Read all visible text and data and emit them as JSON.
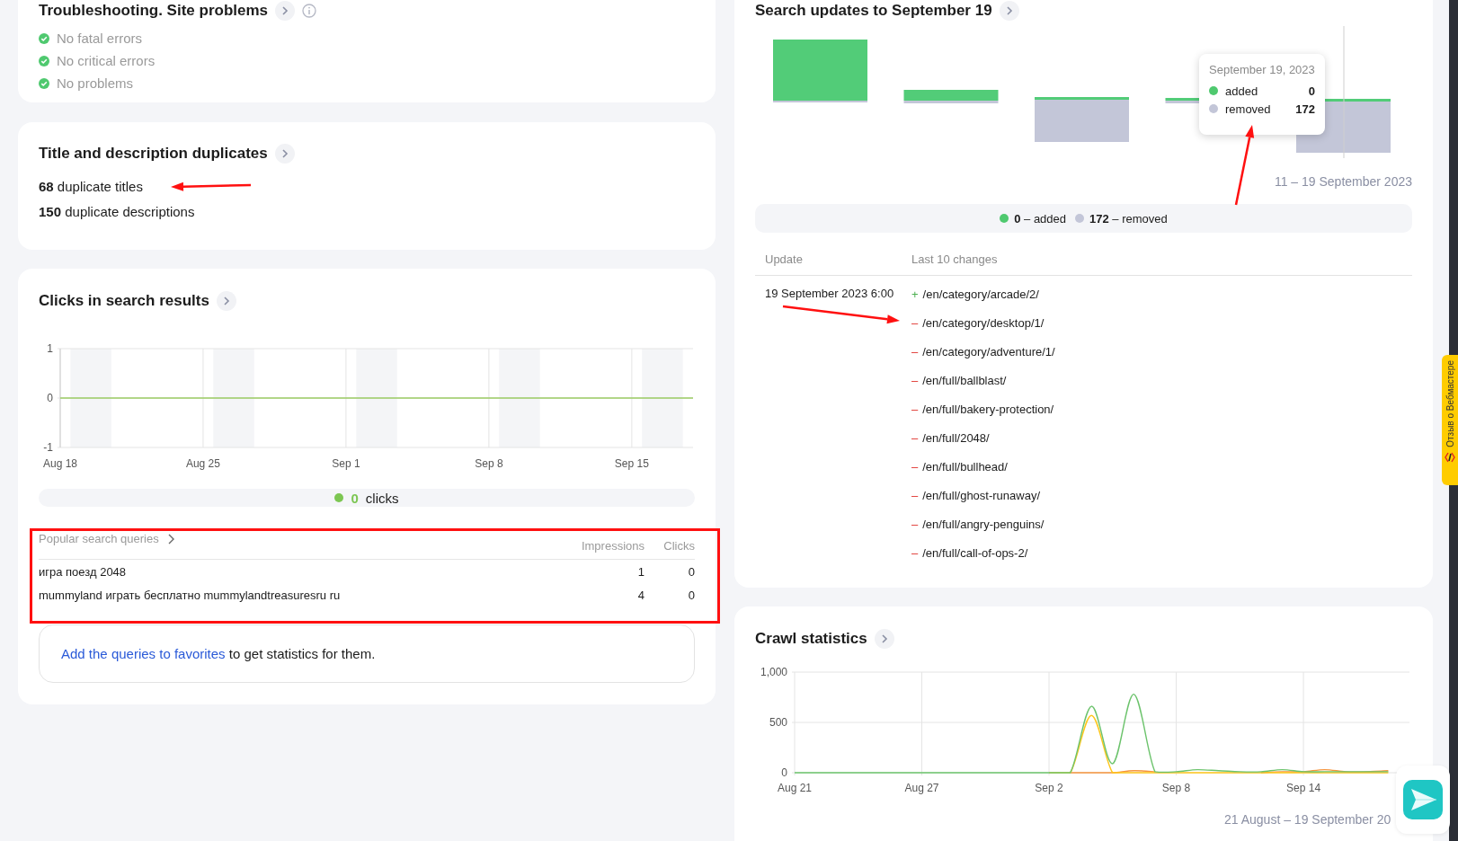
{
  "site_problems": {
    "title": "Troubleshooting. Site problems",
    "items": [
      "No fatal errors",
      "No critical errors",
      "No problems"
    ]
  },
  "duplicates": {
    "title": "Title and description duplicates",
    "lines": [
      {
        "count": "68",
        "label": "duplicate titles"
      },
      {
        "count": "150",
        "label": "duplicate descriptions"
      }
    ]
  },
  "clicks": {
    "title": "Clicks in search results",
    "chart_data": {
      "type": "line",
      "grid": true,
      "categories": [
        "Aug 18",
        null,
        null,
        null,
        null,
        null,
        null,
        "Aug 25",
        null,
        null,
        null,
        null,
        null,
        null,
        "Sep 1",
        null,
        null,
        null,
        null,
        null,
        null,
        "Sep 8",
        null,
        null,
        null,
        null,
        null,
        null,
        "Sep 15",
        null,
        null,
        null
      ],
      "ylim": [
        -1,
        1
      ],
      "yticks": [
        -1,
        0,
        1
      ],
      "series": [
        {
          "color": "#9ccc65",
          "values": [
            0,
            0,
            0,
            0,
            0,
            0,
            0,
            0,
            0,
            0,
            0,
            0,
            0,
            0,
            0,
            0,
            0,
            0,
            0,
            0,
            0,
            0,
            0,
            0,
            0,
            0,
            0,
            0,
            0,
            0,
            0,
            0
          ]
        }
      ]
    },
    "legend": {
      "value": "0",
      "label": "clicks",
      "color": "#7cc652"
    },
    "queries": {
      "title": "Popular search queries",
      "columns": [
        "Impressions",
        "Clicks"
      ],
      "rows": [
        {
          "query": "игра поезд 2048",
          "impressions": "1",
          "clicks": "0"
        },
        {
          "query": "mummyland играть бесплатно mummylandtreasuresru ru",
          "impressions": "4",
          "clicks": "0"
        }
      ]
    },
    "favorites_note": {
      "link": "Add the queries to favorites",
      "text": "to get statistics for them."
    }
  },
  "search_updates": {
    "title": "Search updates to September 19",
    "tooltip": {
      "date": "September 19, 2023",
      "rows": [
        {
          "label": "added",
          "value": "0",
          "color": "#4fc96f"
        },
        {
          "label": "removed",
          "value": "172",
          "color": "#c3c6d8"
        }
      ]
    },
    "period": "11 – 19 September 2023",
    "legend": [
      {
        "text": "**0** – added",
        "color": "#4fc96f"
      },
      {
        "text": "**172** – removed",
        "color": "#c3c6d8"
      }
    ],
    "columns": [
      "Update",
      "Last 10 changes"
    ],
    "update_date": "19 September 2023 6:00",
    "changes": [
      {
        "kind": "added",
        "sign": "+",
        "path": "/en/category/arcade/2/"
      },
      {
        "kind": "removed",
        "sign": "–",
        "path": "/en/category/desktop/1/"
      },
      {
        "kind": "removed",
        "sign": "–",
        "path": "/en/category/adventure/1/"
      },
      {
        "kind": "removed",
        "sign": "–",
        "path": "/en/full/ballblast/"
      },
      {
        "kind": "removed",
        "sign": "–",
        "path": "/en/full/bakery-protection/"
      },
      {
        "kind": "removed",
        "sign": "–",
        "path": "/en/full/2048/"
      },
      {
        "kind": "removed",
        "sign": "–",
        "path": "/en/full/bullhead/"
      },
      {
        "kind": "removed",
        "sign": "–",
        "path": "/en/full/ghost-runaway/"
      },
      {
        "kind": "removed",
        "sign": "–",
        "path": "/en/full/angry-penguins/"
      },
      {
        "kind": "removed",
        "sign": "–",
        "path": "/en/full/call-of-ops-2/"
      }
    ]
  },
  "crawl": {
    "title": "Crawl statistics",
    "chart_data": {
      "type": "line",
      "grid": true,
      "categories": [
        "Aug 21",
        null,
        null,
        null,
        null,
        null,
        "Aug 27",
        null,
        null,
        null,
        null,
        null,
        "Sep 2",
        null,
        null,
        null,
        null,
        null,
        "Sep 8",
        null,
        null,
        null,
        null,
        null,
        "Sep 14",
        null,
        null,
        null,
        null,
        null
      ],
      "ylim": [
        0,
        1000
      ],
      "yticks": [
        0,
        500,
        {
          "value": 1000,
          "label": "1,000"
        }
      ],
      "series": [
        {
          "color": "#6cc36c",
          "values": [
            0,
            0,
            0,
            0,
            0,
            0,
            0,
            0,
            0,
            0,
            0,
            0,
            0,
            0,
            660,
            90,
            780,
            10,
            10,
            30,
            20,
            10,
            10,
            30,
            10,
            10,
            10,
            10,
            10,
            null
          ]
        },
        {
          "color": "#ffc61a",
          "values": [
            null,
            null,
            null,
            null,
            null,
            null,
            null,
            null,
            null,
            null,
            null,
            null,
            0,
            0,
            570,
            0,
            0,
            0,
            0,
            0,
            0,
            0,
            0,
            0,
            0,
            0,
            0,
            0,
            0,
            null
          ]
        },
        {
          "color": "#f5943c",
          "values": [
            null,
            null,
            null,
            null,
            null,
            null,
            null,
            null,
            null,
            null,
            null,
            null,
            null,
            0,
            0,
            0,
            20,
            10,
            null,
            null,
            null,
            null,
            0,
            10,
            10,
            30,
            10,
            10,
            20,
            null
          ]
        }
      ]
    },
    "period": "21 August – 19 September 20"
  },
  "feedback_tab": {
    "label": "Отзыв о Вебмастере"
  }
}
